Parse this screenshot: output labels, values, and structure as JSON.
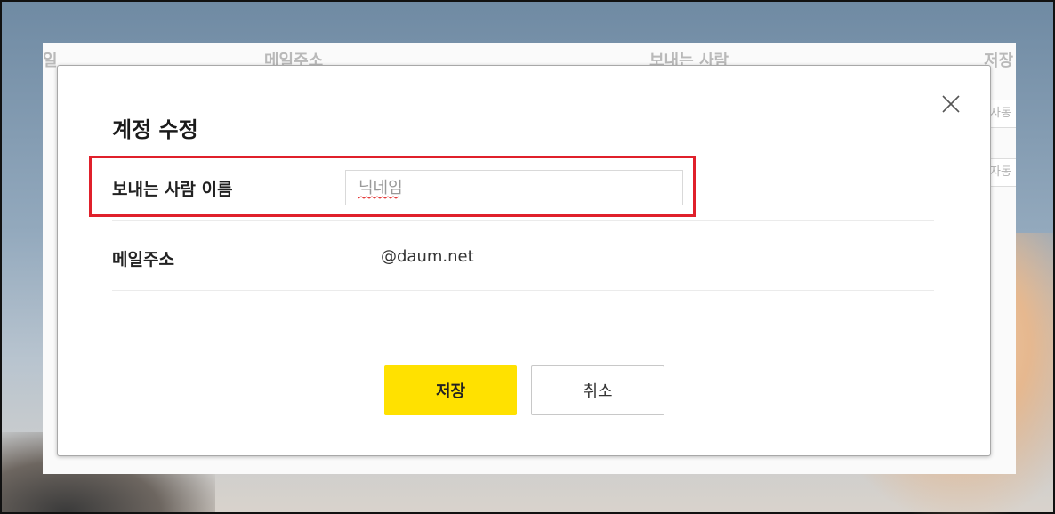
{
  "background": {
    "columns": [
      "일",
      "메일주소",
      "보내는 사람",
      "저장"
    ],
    "side_buttons": [
      "자동",
      "자동"
    ]
  },
  "modal": {
    "title": "계정 수정",
    "close_icon": "close-icon",
    "fields": {
      "sender_name": {
        "label": "보내는 사람 이름",
        "placeholder": "닉네임",
        "value": ""
      },
      "email": {
        "label": "메일주소",
        "value": "@daum.net"
      }
    },
    "buttons": {
      "save": "저장",
      "cancel": "취소"
    }
  },
  "colors": {
    "save_button": "#ffe100",
    "highlight": "#e0202b"
  }
}
